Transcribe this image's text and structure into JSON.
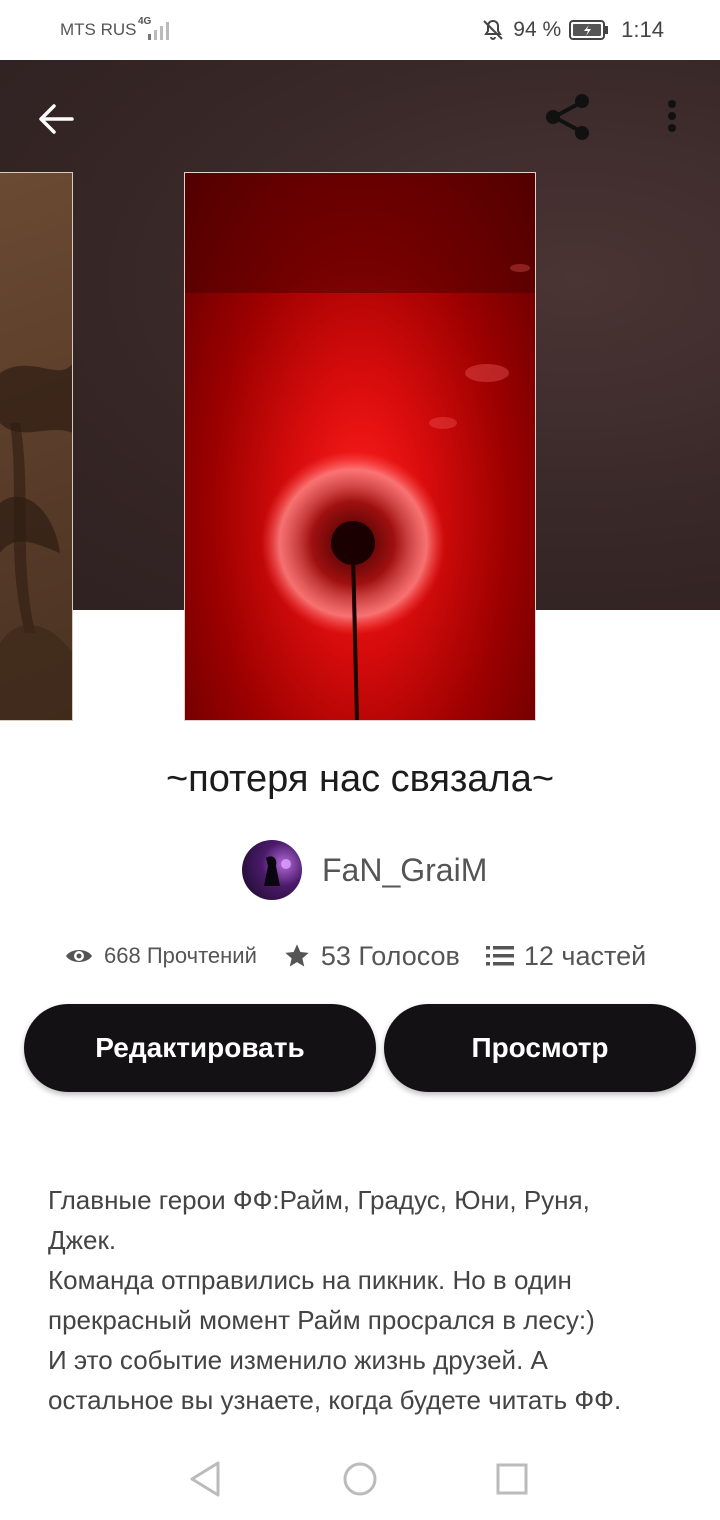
{
  "status_bar": {
    "carrier": "MTS RUS",
    "network": "4G",
    "battery_percent": "94 %",
    "time": "1:14"
  },
  "header": {
    "back_icon": "arrow-left-icon",
    "share_icon": "share-icon",
    "more_icon": "more-vertical-icon"
  },
  "book": {
    "title": "~потеря нас связала~",
    "author": "FaN_GraiM",
    "stats": {
      "views": "668 Прочтений",
      "votes": "53 Голосов",
      "parts": "12 частей"
    },
    "description_lines": [
      "Главные герои ФФ:Райм, Градус, Юни, Руня,",
      "Джек.",
      "Команда отправились на пикник. Но в один",
      "прекрасный момент Райм просрался в лесу:)",
      "И это событие изменило жизнь друзей. А",
      "остальное вы узнаете, когда будете читать ФФ."
    ]
  },
  "actions": {
    "edit_label": "Редактировать",
    "view_label": "Просмотр"
  },
  "colors": {
    "button_bg": "#131113",
    "hero_bg": "#3a2a2a",
    "cover_red": "#d80c0c"
  }
}
